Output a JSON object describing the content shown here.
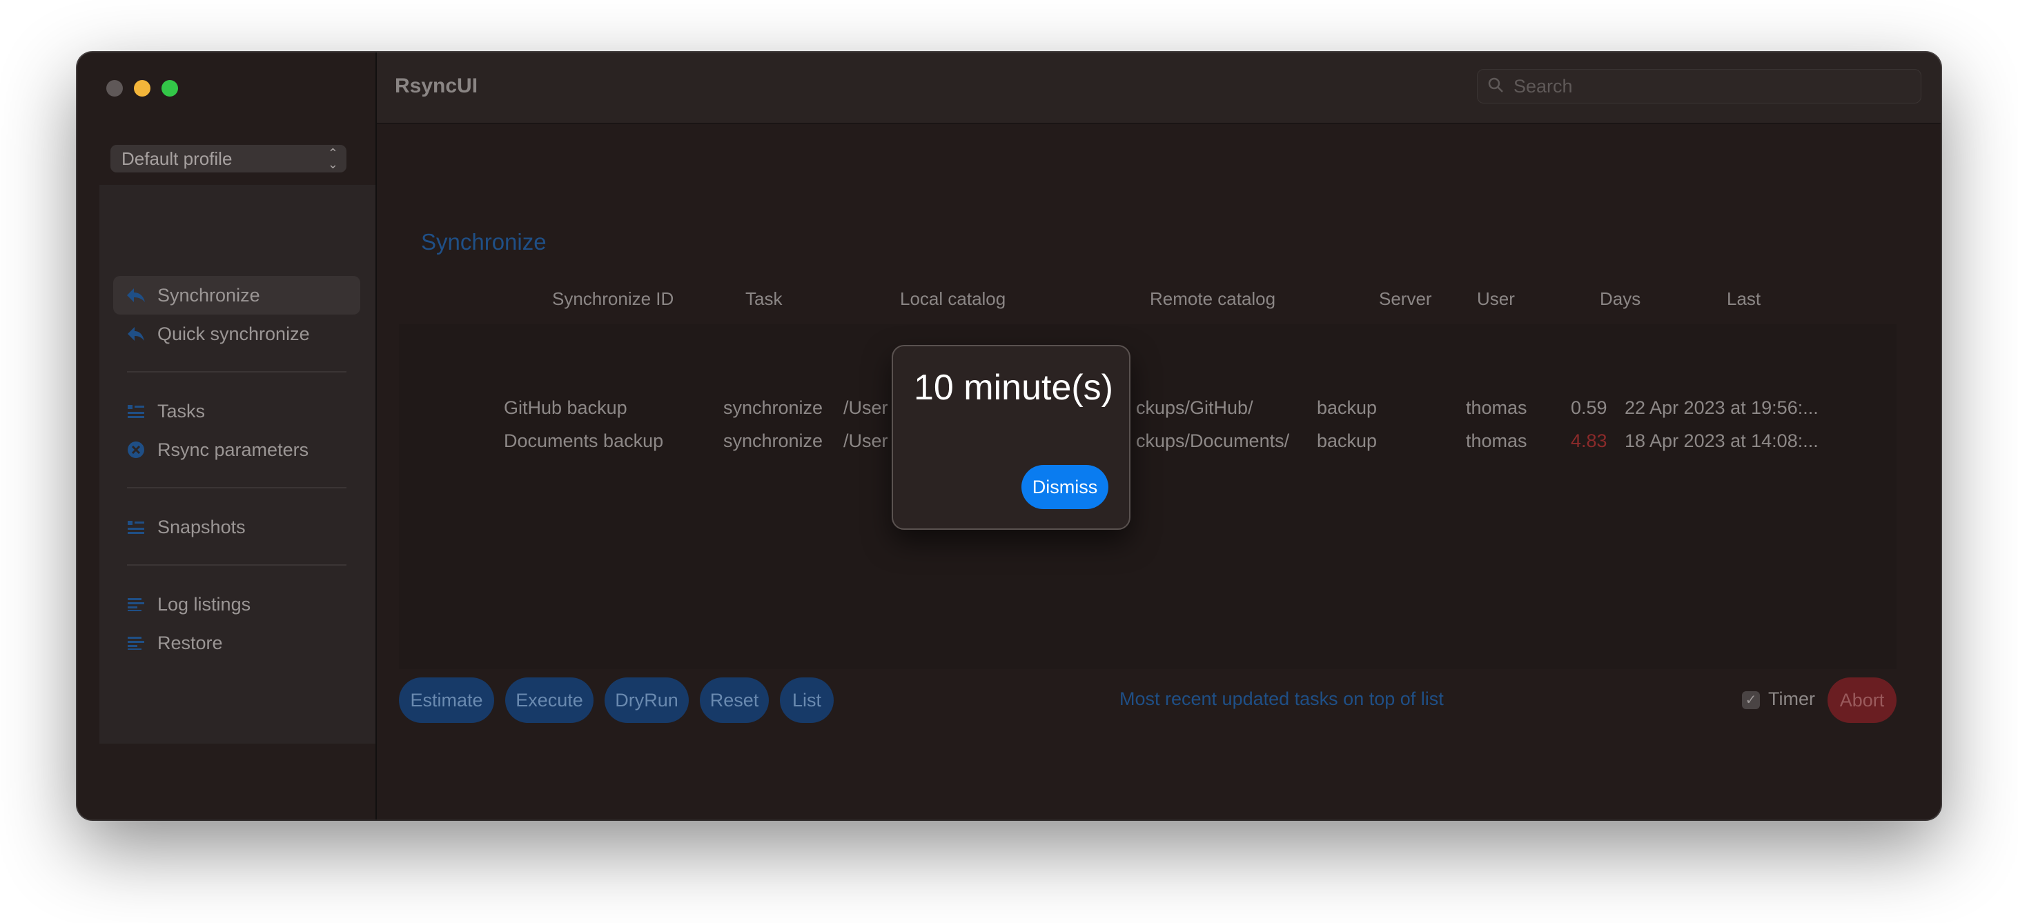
{
  "app": {
    "title": "RsyncUI"
  },
  "search": {
    "placeholder": "Search"
  },
  "profile": {
    "selected": "Default profile"
  },
  "sidebar": {
    "items": [
      {
        "label": "Synchronize",
        "icon": "synchronize-icon"
      },
      {
        "label": "Quick synchronize",
        "icon": "quick-synchronize-icon"
      },
      {
        "label": "Tasks",
        "icon": "tasks-icon"
      },
      {
        "label": "Rsync parameters",
        "icon": "rsync-parameters-icon"
      },
      {
        "label": "Snapshots",
        "icon": "snapshots-icon"
      },
      {
        "label": "Log listings",
        "icon": "log-listings-icon"
      },
      {
        "label": "Restore",
        "icon": "restore-icon"
      }
    ]
  },
  "main": {
    "section_title": "Synchronize",
    "columns": [
      "Synchronize ID",
      "Task",
      "Local catalog",
      "Remote catalog",
      "Server",
      "User",
      "Days",
      "Last"
    ],
    "rows": [
      {
        "id": "GitHub backup",
        "task": "synchronize",
        "local": "/User",
        "remote": "ckups/GitHub/",
        "server": "backup",
        "user": "thomas",
        "days": "0.59",
        "last": "22 Apr 2023 at 19:56:..."
      },
      {
        "id": "Documents backup",
        "task": "synchronize",
        "local": "/User",
        "remote": "ckups/Documents/",
        "server": "backup",
        "user": "thomas",
        "days": "4.83",
        "last": "18 Apr 2023 at 14:08:..."
      }
    ]
  },
  "footer": {
    "buttons": [
      "Estimate",
      "Execute",
      "DryRun",
      "Reset",
      "List"
    ],
    "note": "Most recent updated tasks on top of list",
    "timer_label": "Timer",
    "timer_checked": true,
    "abort_label": "Abort"
  },
  "modal": {
    "message": "10 minute(s)",
    "dismiss_label": "Dismiss"
  },
  "colors": {
    "accent": "#0a7cf0",
    "danger": "#8b2a2a",
    "window_bg": "#231b1a"
  }
}
